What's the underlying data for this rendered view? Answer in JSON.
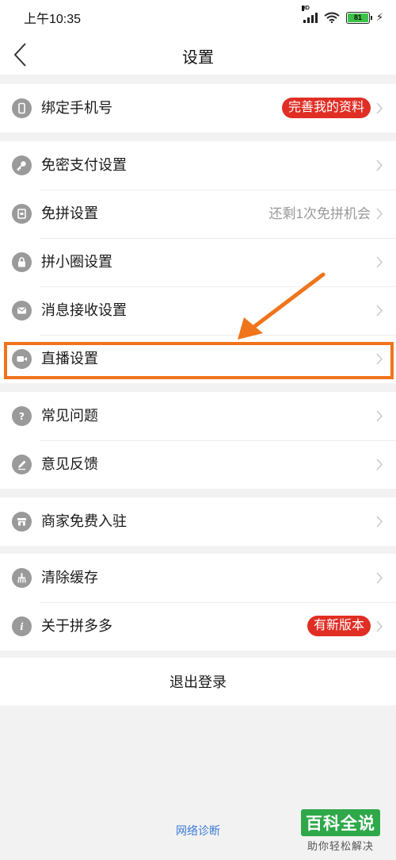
{
  "status_bar": {
    "time": "上午10:35",
    "network_label": "HD",
    "battery_level": "81"
  },
  "nav": {
    "title": "设置"
  },
  "groups": [
    {
      "rows": [
        {
          "label": "绑定手机号",
          "icon": "phone-icon",
          "badge": "完善我的资料"
        }
      ]
    },
    {
      "rows": [
        {
          "label": "免密支付设置",
          "icon": "key-icon"
        },
        {
          "label": "免拼设置",
          "icon": "card-icon",
          "value": "还剩1次免拼机会"
        },
        {
          "label": "拼小圈设置",
          "icon": "lock-icon"
        },
        {
          "label": "消息接收设置",
          "icon": "mail-icon"
        },
        {
          "label": "直播设置",
          "icon": "video-camera-icon"
        }
      ]
    },
    {
      "rows": [
        {
          "label": "常见问题",
          "icon": "question-icon"
        },
        {
          "label": "意见反馈",
          "icon": "pencil-icon"
        }
      ]
    },
    {
      "rows": [
        {
          "label": "商家免费入驻",
          "icon": "store-icon"
        }
      ]
    },
    {
      "rows": [
        {
          "label": "清除缓存",
          "icon": "broom-icon"
        },
        {
          "label": "关于拼多多",
          "icon": "info-icon",
          "badge": "有新版本"
        }
      ]
    }
  ],
  "logout_label": "退出登录",
  "network_diagnosis_label": "网络诊断",
  "watermark": {
    "title": "百科全说",
    "subtitle": "助你轻松解决"
  },
  "colors": {
    "badge": "#e02e24",
    "highlight": "#f0741c",
    "link": "#3a7bd5"
  }
}
